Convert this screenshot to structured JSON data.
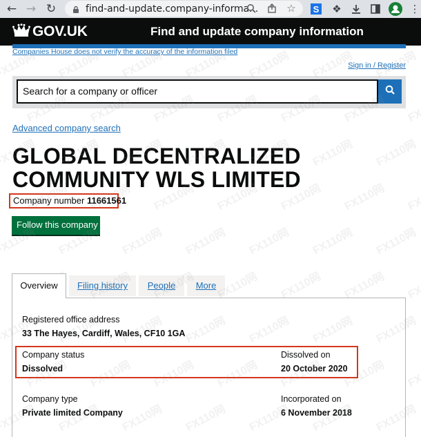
{
  "browser": {
    "url": "find-and-update.company-informa...",
    "icons": [
      "back-icon",
      "forward-icon",
      "reload-icon",
      "lock-icon",
      "zoom-icon",
      "share-icon",
      "star-icon",
      "extension-s-icon",
      "puzzle-icon",
      "download-icon",
      "sidepanel-icon",
      "profile-icon",
      "menu-icon"
    ]
  },
  "header": {
    "logo": "GOV.UK",
    "service_name": "Find and update company information",
    "disclaimer": "Companies House does not verify the accuracy of the information filed",
    "sign_in": "Sign in / Register"
  },
  "search": {
    "placeholder": "Search for a company or officer",
    "advanced_link": "Advanced company search"
  },
  "company": {
    "name_line1": "GLOBAL DECENTRALIZED",
    "name_line2": "COMMUNITY WLS LIMITED",
    "number_label": "Company number",
    "number": "11661561",
    "follow_button": "Follow this company"
  },
  "tabs": [
    {
      "label": "Overview",
      "active": true
    },
    {
      "label": "Filing history",
      "active": false
    },
    {
      "label": "People",
      "active": false
    },
    {
      "label": "More",
      "active": false
    }
  ],
  "overview": {
    "registered_office_label": "Registered office address",
    "registered_office_value": "33 The Hayes, Cardiff, Wales, CF10 1GA",
    "status_label": "Company status",
    "status_value": "Dissolved",
    "dissolved_label": "Dissolved on",
    "dissolved_value": "20 October 2020",
    "type_label": "Company type",
    "type_value": "Private limited Company",
    "incorporated_label": "Incorporated on",
    "incorporated_value": "6 November 2018"
  },
  "watermark": "FX110网",
  "colors": {
    "govuk_black": "#0b0c0c",
    "govuk_blue": "#1d70b8",
    "govuk_green": "#00703c",
    "highlight_red": "#d4351c",
    "search_panel": "#dee0e2"
  }
}
